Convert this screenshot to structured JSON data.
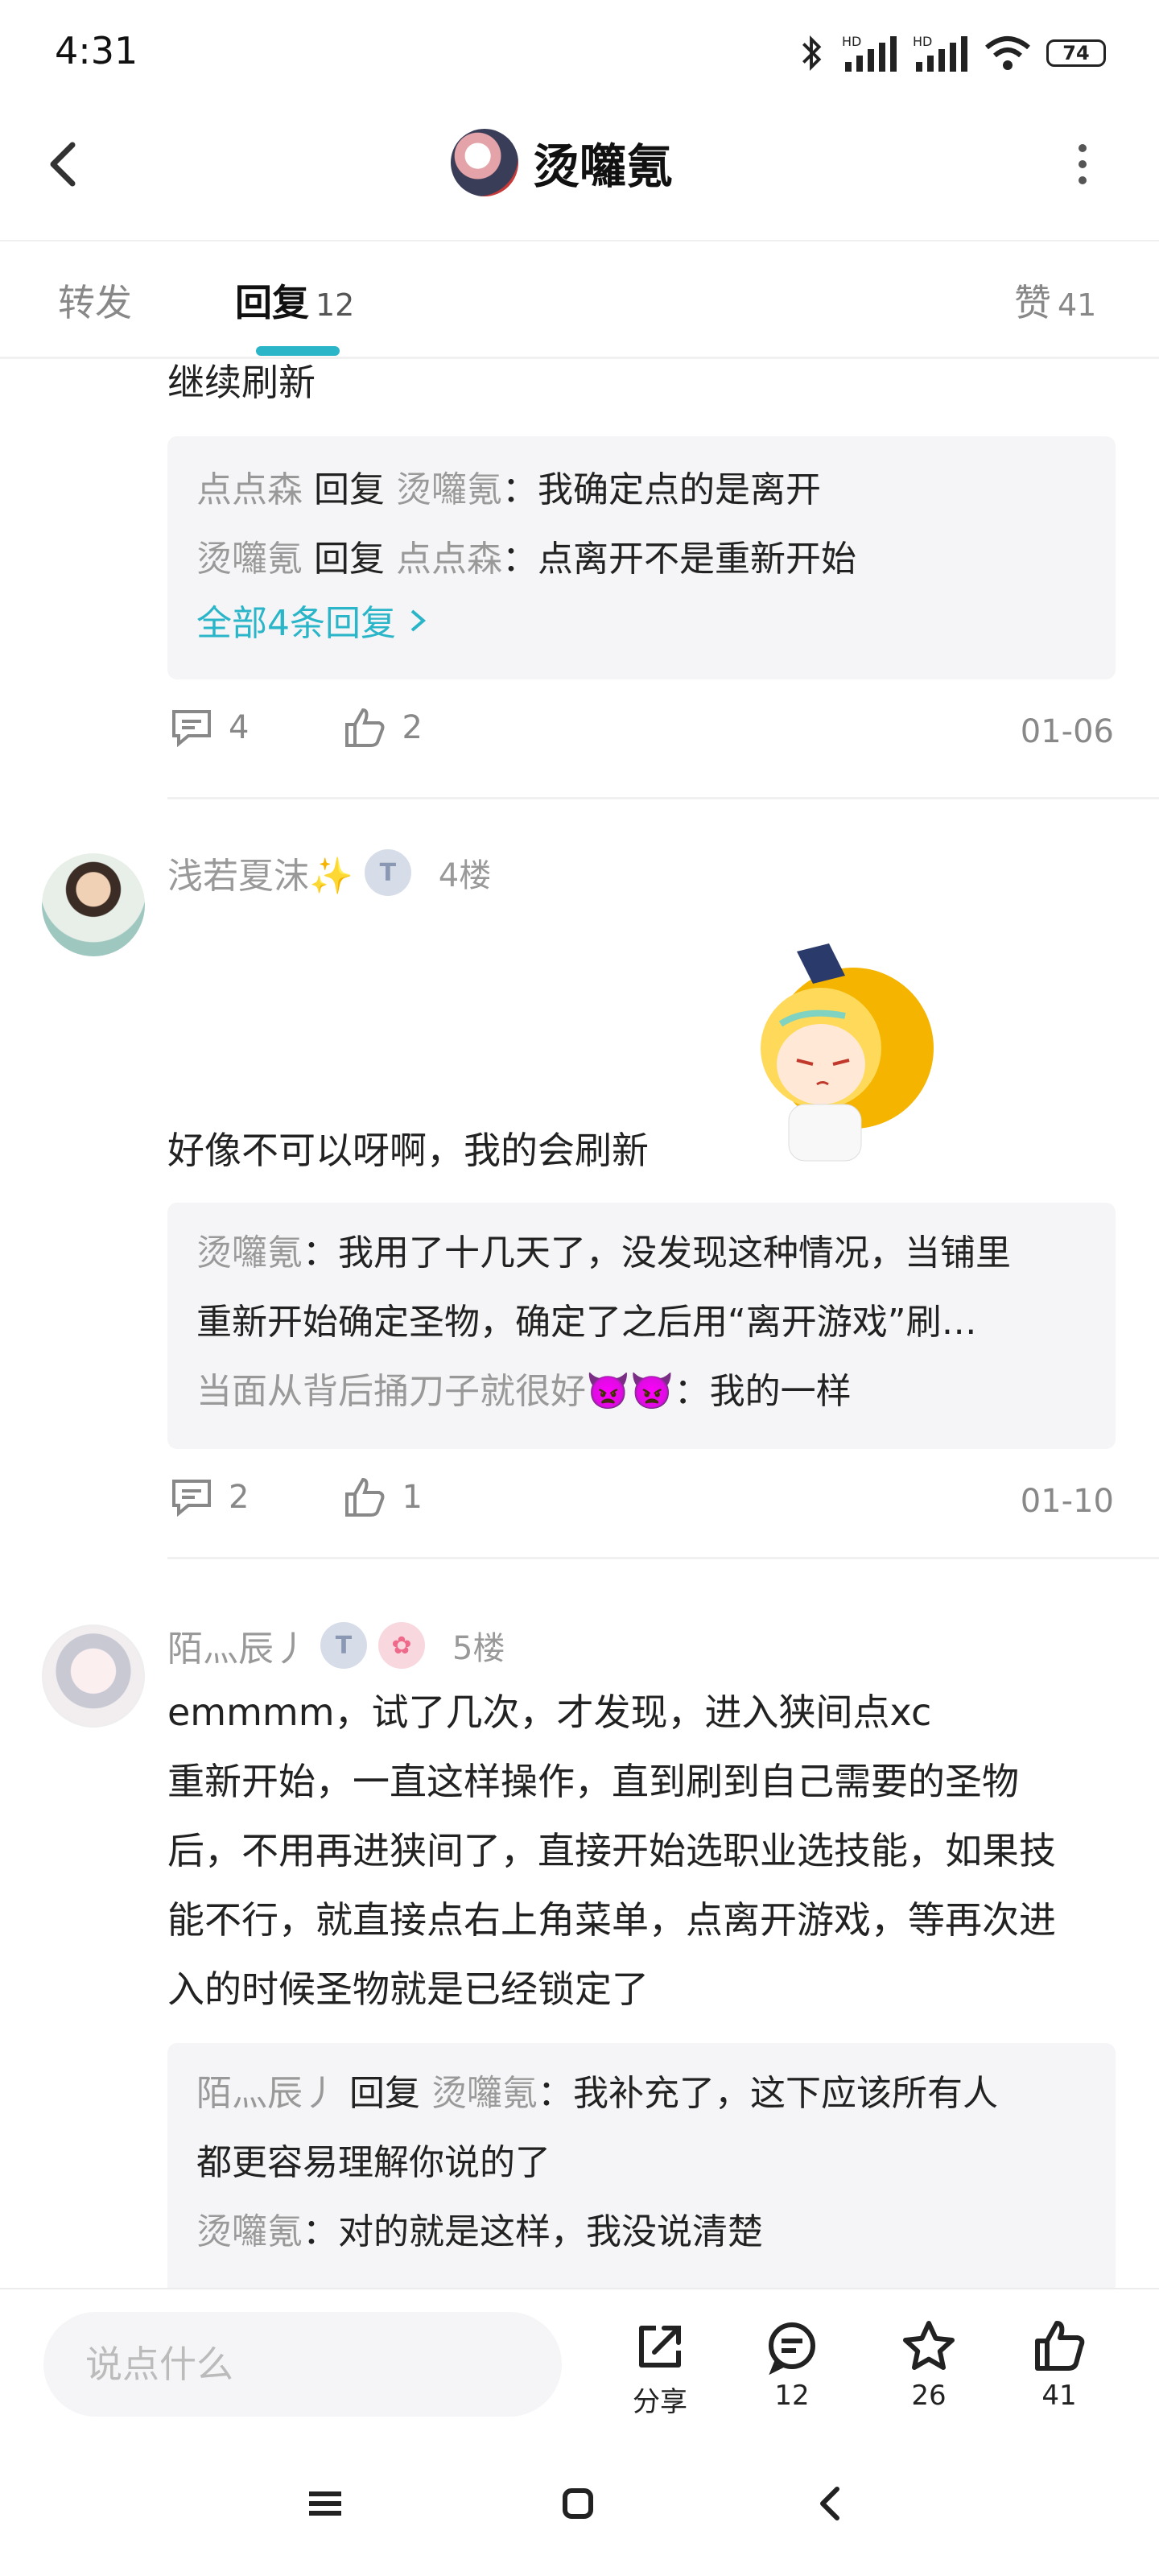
{
  "status": {
    "time": "4:31",
    "battery": "74"
  },
  "header": {
    "title": "烫囖氪"
  },
  "tabs": [
    {
      "label": "转发",
      "count": ""
    },
    {
      "label": "回复",
      "count": "12"
    },
    {
      "label": "赞",
      "count": "41"
    }
  ],
  "comment3": {
    "text": "继续刷新",
    "replies": [
      {
        "from": "点点森",
        "verb": "回复",
        "to": "烫囖氪",
        "text": "：我确定点的是离开"
      },
      {
        "from": "烫囖氪",
        "verb": "回复",
        "to": "点点森",
        "text": "：点离开不是重新开始"
      }
    ],
    "all_replies": "全部4条回复",
    "reply_count": "4",
    "like_count": "2",
    "date": "01-06"
  },
  "comment4": {
    "user": "浅若夏沫✨",
    "badge": "T",
    "floor": "4楼",
    "text": "好像不可以呀啊，我的会刷新",
    "replies": [
      {
        "from": "烫囖氪",
        "text": "：我用了十几天了，没发现这种情况，当铺里"
      },
      {
        "from": "",
        "text": "重新开始确定圣物，确定了之后用“离开游戏”刷…"
      },
      {
        "from": "当面从背后捅刀子就很好👿👿",
        "text": "：我的一样"
      }
    ],
    "reply_count": "2",
    "like_count": "1",
    "date": "01-10"
  },
  "comment5": {
    "user": "陌灬辰丿",
    "badge": "T",
    "floor": "5楼",
    "lines": [
      "emmmm，试了几次，才发现，进入狭间点xc",
      "重新开始，一直这样操作，直到刷到自己需要的圣物",
      "后，不用再进狭间了，直接开始选职业选技能，如果技",
      "能不行，就直接点右上角菜单，点离开游戏，等再次进",
      "入的时候圣物就是已经锁定了"
    ],
    "replies": [
      {
        "from": "陌灬辰丿",
        "verb": "回复",
        "to": "烫囖氪",
        "text": "：我补充了，这下应该所有人"
      },
      {
        "from": "",
        "verb": "",
        "to": "",
        "text": "都更容易理解你说的了"
      },
      {
        "from": "烫囖氪",
        "verb": "",
        "to": "",
        "text": "：对的就是这样，我没说清楚"
      }
    ]
  },
  "bottom": {
    "placeholder": "说点什么",
    "share": "分享",
    "comments": "12",
    "favorites": "26",
    "likes": "41"
  },
  "colors": {
    "accent": "#2bb5c8",
    "secondary_text": "#999999"
  }
}
